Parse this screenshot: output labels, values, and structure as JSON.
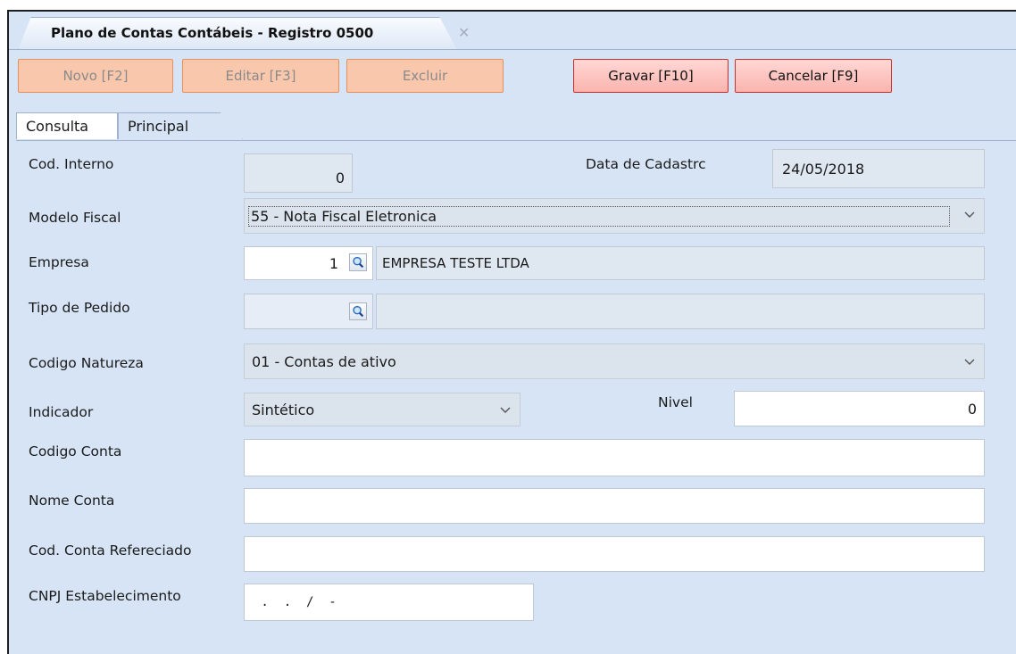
{
  "window": {
    "title": "Plano de Contas Contábeis - Registro 0500"
  },
  "toolbar": {
    "novo": "Novo [F2]",
    "editar": "Editar [F3]",
    "excluir": "Excluir",
    "gravar": "Gravar [F10]",
    "cancelar": "Cancelar [F9]"
  },
  "tabs": {
    "consulta": "Consulta",
    "principal": "Principal"
  },
  "form": {
    "cod_interno": {
      "label": "Cod. Interno",
      "value": "0"
    },
    "data_cadastro": {
      "label": "Data de Cadastrc",
      "value": "24/05/2018"
    },
    "modelo_fiscal": {
      "label": "Modelo Fiscal",
      "value": "55 - Nota Fiscal Eletronica"
    },
    "empresa": {
      "label": "Empresa",
      "code": "1",
      "name": "EMPRESA TESTE LTDA"
    },
    "tipo_pedido": {
      "label": "Tipo de Pedido",
      "code": "",
      "name": ""
    },
    "codigo_natureza": {
      "label": "Codigo Natureza",
      "value": "01 - Contas de ativo"
    },
    "indicador": {
      "label": "Indicador",
      "value": "Sintético"
    },
    "nivel": {
      "label": "Nivel",
      "value": "0"
    },
    "codigo_conta": {
      "label": "Codigo Conta",
      "value": ""
    },
    "nome_conta": {
      "label": "Nome Conta",
      "value": ""
    },
    "cod_conta_ref": {
      "label": "Cod. Conta Refereciado",
      "value": ""
    },
    "cnpj": {
      "label": "CNPJ Estabelecimento",
      "value": " .  .  /  -"
    }
  },
  "colors": {
    "background": "#d6e4f5",
    "button_disabled": "#f9c8ac",
    "button_active": "#fbb4ae",
    "button_active_border": "#c9322c"
  },
  "icons": {
    "close_tab": "close-icon",
    "lookup": "magnifier-icon",
    "dropdown": "chevron-down-icon"
  }
}
